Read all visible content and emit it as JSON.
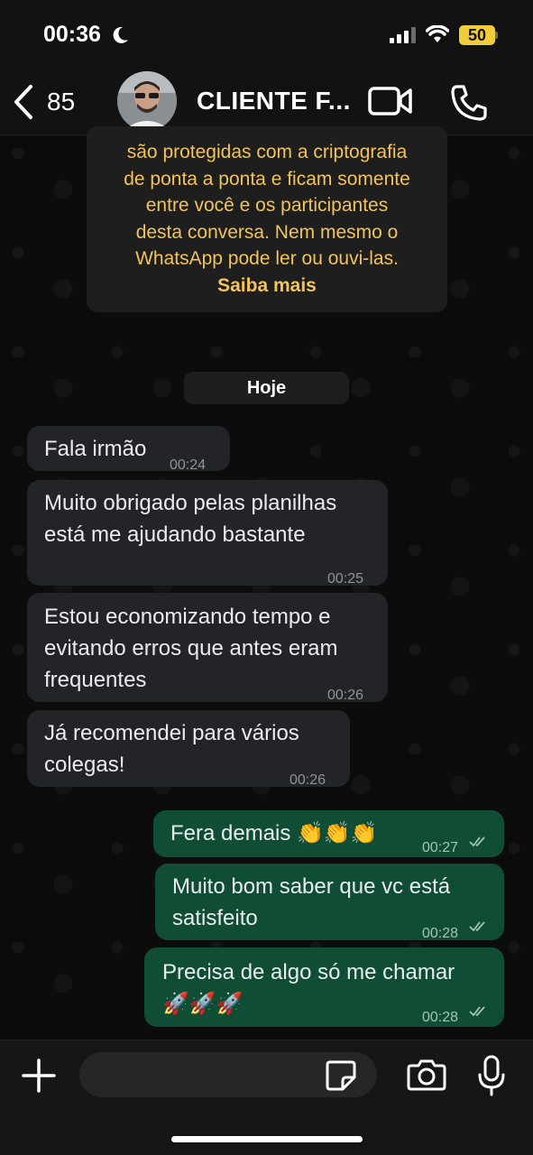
{
  "status_bar": {
    "time": "00:36",
    "battery": "50",
    "icons": [
      "moon-icon",
      "signal-icon",
      "wifi-icon",
      "battery-icon"
    ]
  },
  "header": {
    "back_count": "85",
    "contact_name": "CLIENTE F...",
    "icons": [
      "chevron-left-icon",
      "video-call-icon",
      "phone-icon"
    ]
  },
  "encryption_notice": {
    "lines": [
      "são protegidas com a criptografia",
      "de ponta a ponta e ficam somente",
      "entre você e os participantes",
      "desta conversa. Nem mesmo o",
      "WhatsApp pode ler ou ouvi-las."
    ],
    "link": "Saiba mais"
  },
  "date_label": "Hoje",
  "messages": [
    {
      "dir": "in",
      "lines": [
        "Fala irmão"
      ],
      "time": "00:24"
    },
    {
      "dir": "in",
      "lines": [
        "Muito obrigado pelas planilhas",
        "está me ajudando bastante"
      ],
      "time": "00:25"
    },
    {
      "dir": "in",
      "lines": [
        "Estou economizando tempo e",
        "evitando erros que antes eram",
        "frequentes"
      ],
      "time": "00:26"
    },
    {
      "dir": "in",
      "lines": [
        "Já recomendei para vários",
        "colegas!"
      ],
      "time": "00:26"
    },
    {
      "dir": "out",
      "lines": [
        "Fera demais 👏👏👏"
      ],
      "time": "00:27",
      "status": "read"
    },
    {
      "dir": "out",
      "lines": [
        "Muito bom saber que vc está",
        "satisfeito"
      ],
      "time": "00:28",
      "status": "read"
    },
    {
      "dir": "out",
      "lines": [
        "Precisa de algo só me chamar",
        "🚀🚀🚀"
      ],
      "time": "00:28",
      "status": "read"
    }
  ],
  "composer": {
    "placeholder": "",
    "icons": [
      "plus-icon",
      "sticker-icon",
      "camera-icon",
      "microphone-icon"
    ]
  },
  "colors": {
    "incoming_bubble": "#222427",
    "outgoing_bubble": "#0f4d35",
    "notice_text": "#f2c358",
    "battery": "#f2cd3a"
  }
}
